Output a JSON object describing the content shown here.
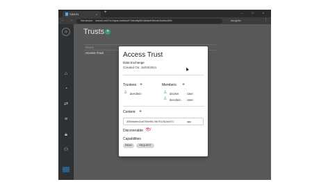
{
  "browser": {
    "tab_title": "SIMON",
    "tab_close": "×",
    "new_tab": "+",
    "window_controls": "– □ ×",
    "nav_glyphs": "← → ↻",
    "security": "Not secure",
    "url": "simonl.uni19.ir.mipas.net/trust/?/identity/8e1d8abeHbevier5oekhd269",
    "incognito_label": "Incognito",
    "menu": "⋮"
  },
  "sidebar": {
    "items": [
      {
        "name": "home-icon",
        "glyph": "⌂"
      },
      {
        "name": "dashboard-icon",
        "glyph": "◔"
      },
      {
        "name": "share-icon",
        "glyph": "⇄"
      },
      {
        "name": "database-icon",
        "glyph": "≡"
      },
      {
        "name": "lock-icon",
        "glyph": "🔒︎"
      },
      {
        "name": "user-settings-icon",
        "glyph": "⚇"
      }
    ]
  },
  "page": {
    "title": "Trusts",
    "add_glyph": "+",
    "column_name": "Name",
    "row_name": "Access Trust"
  },
  "modal": {
    "title": "Access Trust",
    "subtitle": "Data Exchange",
    "created": "Created On: 16/03/2021",
    "trustees_label": "Trustees",
    "members_label": "Members",
    "add_glyph": "+",
    "trustees": [
      {
        "name": "deAdmin"
      }
    ],
    "members": [
      {
        "name": "deUser",
        "role": "User"
      },
      {
        "name": "deAdmin",
        "role": "User"
      }
    ],
    "content_label": "Content",
    "content_hash": "330b6d5e41c6745ef917db7512624e371",
    "content_type": "app",
    "discoverable_label": "Discoverable",
    "discoverable_icon": "👁︎̸",
    "capabilities_label": "Capabilities",
    "capabilities": [
      "READ",
      "REQUEST"
    ]
  },
  "colors": {
    "accent": "#3a9b73",
    "danger": "#e0245e",
    "sidebar": "#2e3133",
    "overlay_bg": "#595959"
  }
}
